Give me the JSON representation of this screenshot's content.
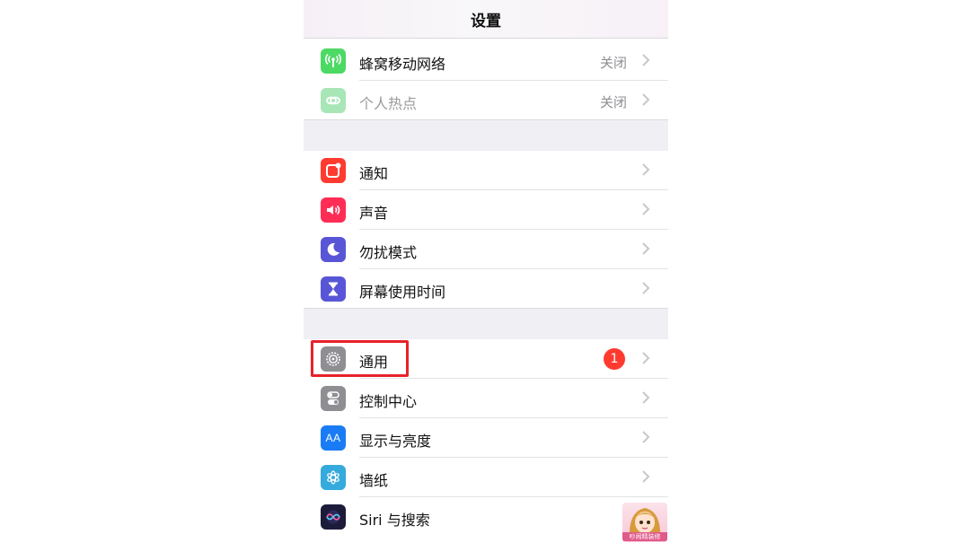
{
  "nav": {
    "title": "设置"
  },
  "group1": [
    {
      "label": "蜂窝移动网络",
      "value": "关闭",
      "icon": "cellular-icon",
      "color": "#4cd964"
    },
    {
      "label": "个人热点",
      "value": "关闭",
      "icon": "hotspot-icon",
      "color": "#a8e6b8"
    }
  ],
  "group2": [
    {
      "label": "通知",
      "icon": "notifications-icon",
      "color": "#ff3b30"
    },
    {
      "label": "声音",
      "icon": "sounds-icon",
      "color": "#ff2d55"
    },
    {
      "label": "勿扰模式",
      "icon": "moon-icon",
      "color": "#5856d6"
    },
    {
      "label": "屏幕使用时间",
      "icon": "hourglass-icon",
      "color": "#5856d6"
    }
  ],
  "group3": [
    {
      "label": "通用",
      "badge": "1",
      "icon": "gear-icon",
      "color": "#8e8e93"
    },
    {
      "label": "控制中心",
      "icon": "control-center-icon",
      "color": "#8e8e93"
    },
    {
      "label": "显示与亮度",
      "icon_text": "AA",
      "icon": "display-icon",
      "color": "#1a7cf5"
    },
    {
      "label": "墙纸",
      "icon": "wallpaper-icon",
      "color": "#35aadc"
    },
    {
      "label": "Siri 与搜索",
      "icon": "siri-icon",
      "color": "#1c1c3a"
    }
  ],
  "sticker": {
    "text": "吵闹精装修"
  }
}
